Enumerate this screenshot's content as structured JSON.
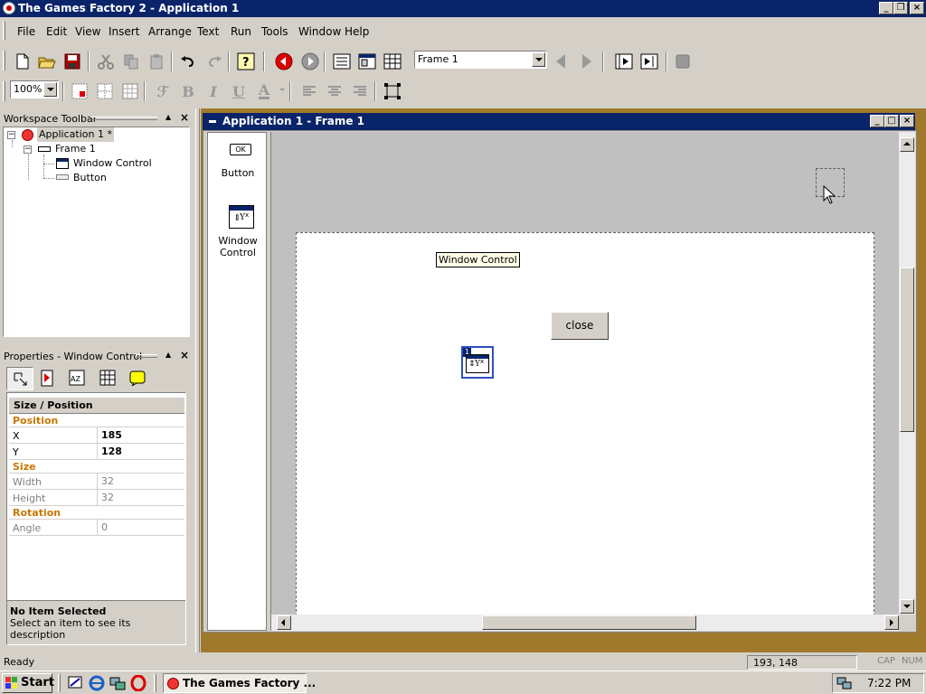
{
  "app": {
    "title": "The Games Factory 2 - Application 1",
    "window_buttons": [
      "_",
      "□",
      "×"
    ]
  },
  "menu": {
    "items": [
      "File",
      "Edit",
      "View",
      "Insert",
      "Arrange",
      "Text",
      "Run",
      "Tools",
      "Window",
      "Help"
    ]
  },
  "toolbar": {
    "frame_select": "Frame 1",
    "zoom": "100%"
  },
  "workspace": {
    "header": "Workspace Toolbar",
    "tree": {
      "app": "Application 1 *",
      "frame": "Frame 1",
      "children": [
        "Window Control",
        "Button"
      ]
    }
  },
  "properties": {
    "header": "Properties - Window Control",
    "group": "Size / Position",
    "sections": {
      "position": "Position",
      "size": "Size",
      "rotation": "Rotation"
    },
    "rows": {
      "x": {
        "name": "X",
        "value": "185"
      },
      "y": {
        "name": "Y",
        "value": "128"
      },
      "width": {
        "name": "Width",
        "value": "32"
      },
      "height": {
        "name": "Height",
        "value": "32"
      },
      "angle": {
        "name": "Angle",
        "value": "0"
      }
    },
    "description_title": "No Item Selected",
    "description_text": "Select an item to see its description"
  },
  "child_window": {
    "title": "Application 1 - Frame 1",
    "palette": {
      "button_icon_text": "OK",
      "button_label": "Button",
      "window_control_label": "Window\nControl"
    },
    "frame_objects": {
      "window_control_label": "Window Control",
      "close_button": "close",
      "wc_badge": "1"
    }
  },
  "status": {
    "text": "Ready",
    "coords": "193, 148",
    "cap": "CAP",
    "num": "NUM"
  },
  "taskbar": {
    "start": "Start",
    "task": "The Games Factory ...",
    "clock": "7:22 PM"
  },
  "colors": {
    "titlebar": "#0a246a",
    "face": "#d4d0c8",
    "mdi_bg": "#a07a2c",
    "section_label": "#c87800"
  }
}
